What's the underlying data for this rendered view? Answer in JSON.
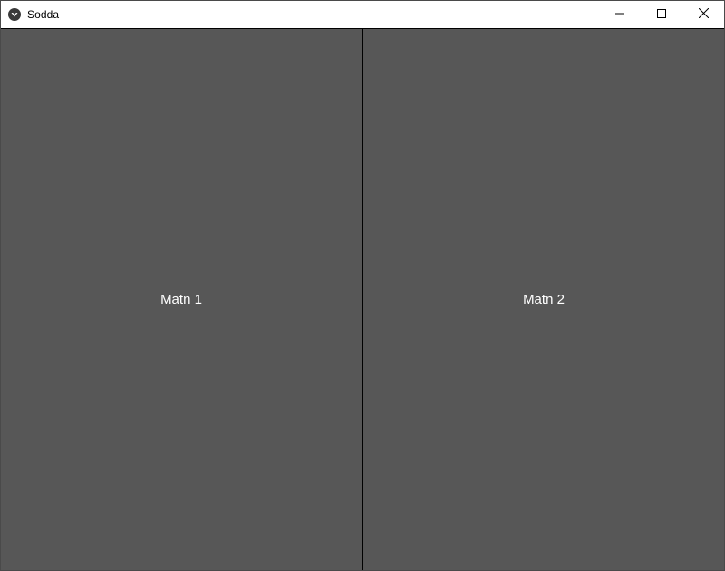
{
  "window": {
    "title": "Sodda",
    "app_icon": "kivy-logo-icon",
    "caption_buttons": {
      "minimize_icon": "minimize-icon",
      "maximize_icon": "maximize-icon",
      "close_icon": "close-icon"
    }
  },
  "panels": [
    {
      "label": "Matn 1"
    },
    {
      "label": "Matn 2"
    }
  ],
  "colors": {
    "panel_background": "#575757",
    "divider": "#000000",
    "label_text": "#ffffff",
    "titlebar": "#ffffff"
  }
}
